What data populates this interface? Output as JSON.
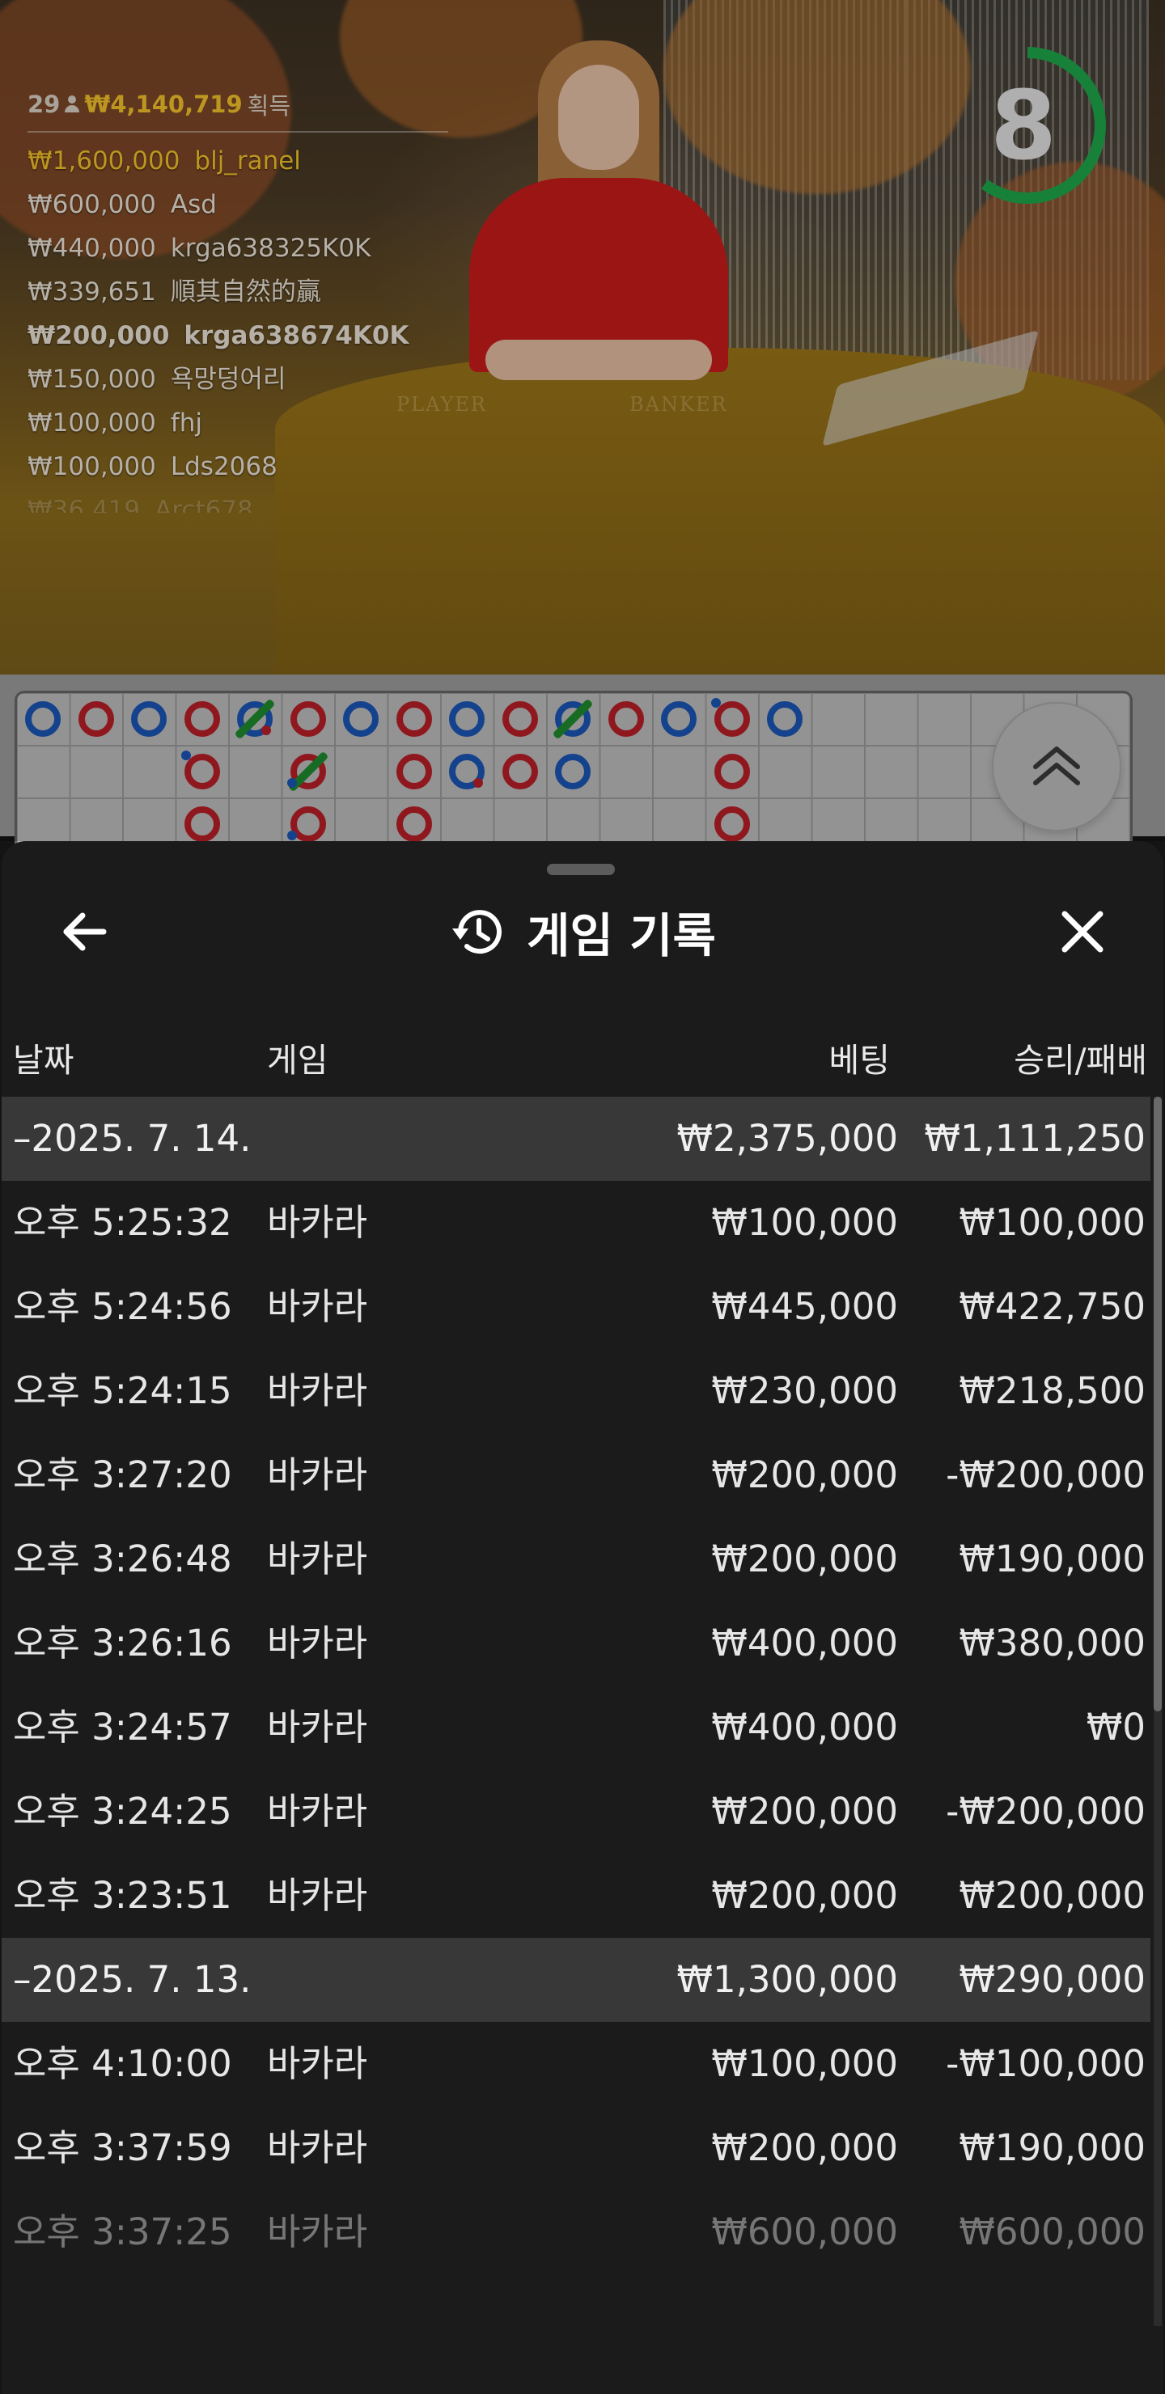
{
  "live": {
    "leaderboard": {
      "players": "29",
      "total_won": "₩4,140,719",
      "total_label": "획득",
      "entries": [
        {
          "amount": "₩1,600,000",
          "name": "blj_ranel"
        },
        {
          "amount": "₩600,000",
          "name": "Asd"
        },
        {
          "amount": "₩440,000",
          "name": "krga638325K0K"
        },
        {
          "amount": "₩339,651",
          "name": "順其自然的贏"
        },
        {
          "amount": "₩200,000",
          "name": "krga638674K0K"
        },
        {
          "amount": "₩150,000",
          "name": "욕망덩어리"
        },
        {
          "amount": "₩100,000",
          "name": "fhj"
        },
        {
          "amount": "₩100,000",
          "name": "Lds2068"
        }
      ]
    },
    "timer": {
      "seconds": "8",
      "progress": 0.6,
      "color": "#1fa64a"
    },
    "table_labels": {
      "player": "PLAYER",
      "banker": "BANKER"
    }
  },
  "history_sheet": {
    "title": "게임 기록",
    "back_icon": "arrow-left-icon",
    "history_icon": "history-icon",
    "close_icon": "close-icon",
    "columns": {
      "date": "날짜",
      "game": "게임",
      "bet": "베팅",
      "result": "승리/패배"
    },
    "groups": [
      {
        "date": "–2025. 7. 14.",
        "bet": "₩2,375,000",
        "result": "₩1,111,250",
        "rows": [
          {
            "time": "오후 5:25:32",
            "game": "바카라",
            "bet": "₩100,000",
            "result": "₩100,000"
          },
          {
            "time": "오후 5:24:56",
            "game": "바카라",
            "bet": "₩445,000",
            "result": "₩422,750"
          },
          {
            "time": "오후 5:24:15",
            "game": "바카라",
            "bet": "₩230,000",
            "result": "₩218,500"
          },
          {
            "time": "오후 3:27:20",
            "game": "바카라",
            "bet": "₩200,000",
            "result": "-₩200,000"
          },
          {
            "time": "오후 3:26:48",
            "game": "바카라",
            "bet": "₩200,000",
            "result": "₩190,000"
          },
          {
            "time": "오후 3:26:16",
            "game": "바카라",
            "bet": "₩400,000",
            "result": "₩380,000"
          },
          {
            "time": "오후 3:24:57",
            "game": "바카라",
            "bet": "₩400,000",
            "result": "₩0"
          },
          {
            "time": "오후 3:24:25",
            "game": "바카라",
            "bet": "₩200,000",
            "result": "-₩200,000"
          },
          {
            "time": "오후 3:23:51",
            "game": "바카라",
            "bet": "₩200,000",
            "result": "₩200,000"
          }
        ]
      },
      {
        "date": "–2025. 7. 13.",
        "bet": "₩1,300,000",
        "result": "₩290,000",
        "rows": [
          {
            "time": "오후 4:10:00",
            "game": "바카라",
            "bet": "₩100,000",
            "result": "-₩100,000"
          },
          {
            "time": "오후 3:37:59",
            "game": "바카라",
            "bet": "₩200,000",
            "result": "₩190,000"
          },
          {
            "time": "오후 3:37:25",
            "game": "바카라",
            "bet": "₩600,000",
            "result": "₩600,000"
          }
        ]
      }
    ]
  },
  "colors": {
    "banker_red": "#b81f28",
    "player_blue": "#1c55b5",
    "tie_green": "#1e8a2e",
    "gold": "#f1c12a"
  }
}
